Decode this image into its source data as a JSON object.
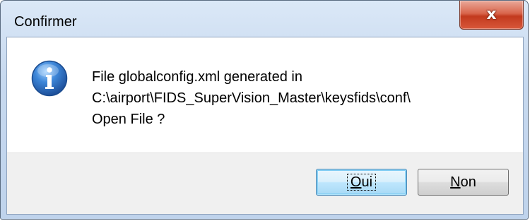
{
  "window": {
    "title": "Confirmer",
    "close_label": "x"
  },
  "icon": "information-icon",
  "message": {
    "line1": "File globalconfig.xml generated in",
    "line2": "C:\\airport\\FIDS_SuperVision_Master\\keysfids\\conf\\",
    "line3": "Open File ?"
  },
  "buttons": {
    "yes": {
      "accel": "O",
      "rest": "ui"
    },
    "no": {
      "accel": "N",
      "rest": "on"
    }
  },
  "colors": {
    "titlebar": "#c7d9ef",
    "close_button": "#c9402a",
    "info_icon": "#2f6fc4",
    "button_area": "#f0f0f0",
    "default_button": "#bee6fd"
  }
}
